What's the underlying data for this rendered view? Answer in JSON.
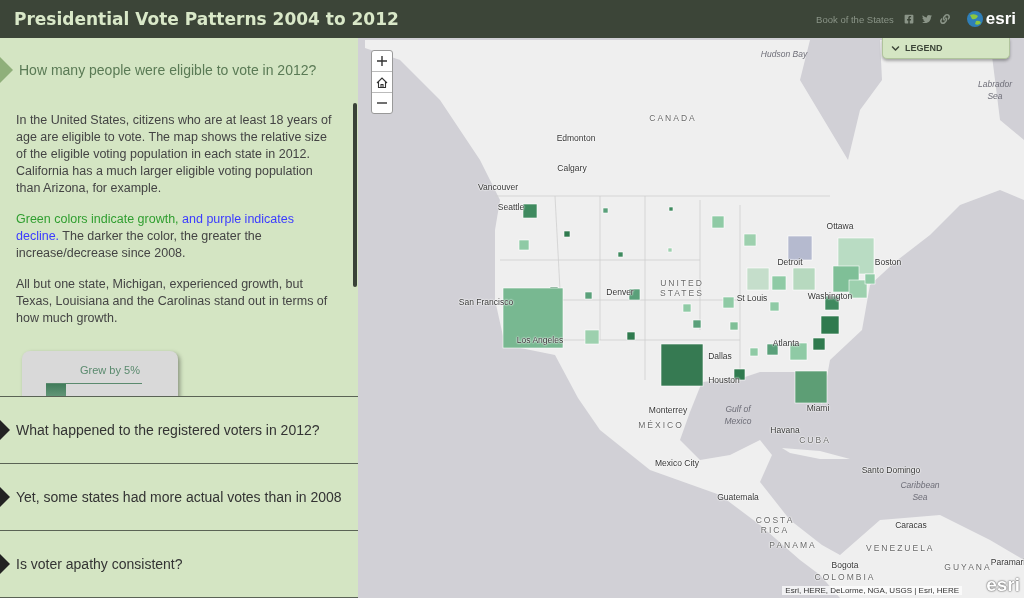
{
  "header": {
    "title": "Presidential Vote Patterns 2004 to 2012",
    "link": "Book of the States",
    "logo": "esri"
  },
  "sections": [
    {
      "title": "How many people were eligible to vote in 2012?",
      "expanded": true,
      "paragraphs": [
        [
          {
            "text": "In the United States, citizens who are at least 18 years of age are eligible to vote. The map shows the relative size of the eligible voting population in each state in 2012. California has a much larger eligible voting population than Arizona, for example."
          }
        ],
        [
          {
            "text": "Green colors indicate growth, ",
            "color": "#2f9e2f"
          },
          {
            "text": "and purple indicates decline.",
            "color": "#3b3bff"
          },
          {
            "text": " The darker the color, the greater the increase/decrease since 2008."
          }
        ],
        [
          {
            "text": "All but one state, Michigan, experienced growth, but Texas, Louisiana and the Carolinas stand out in terms of how much growth."
          }
        ]
      ],
      "chart_title": "Grew by 5%"
    },
    {
      "title": "What happened to the registered voters in 2012?",
      "expanded": false
    },
    {
      "title": "Yet, some states had more actual votes than in 2008",
      "expanded": false
    },
    {
      "title": "Is voter apathy consistent?",
      "expanded": false
    }
  ],
  "map": {
    "legend": {
      "label": "LEGEND",
      "expanded": false
    },
    "labels": [
      {
        "text": "Hudson Bay",
        "kind": "water"
      },
      {
        "text": "Labrador Sea",
        "kind": "water"
      },
      {
        "text": "CANADA",
        "kind": "country"
      },
      {
        "text": "Edmonton",
        "kind": "city"
      },
      {
        "text": "Calgary",
        "kind": "city"
      },
      {
        "text": "Vancouver",
        "kind": "city"
      },
      {
        "text": "Seattle",
        "kind": "city"
      },
      {
        "text": "Ottawa",
        "kind": "city"
      },
      {
        "text": "Detroit",
        "kind": "city"
      },
      {
        "text": "Boston",
        "kind": "city"
      },
      {
        "text": "Denver",
        "kind": "city"
      },
      {
        "text": "UNITED STATES",
        "kind": "country"
      },
      {
        "text": "St Louis",
        "kind": "city"
      },
      {
        "text": "Washington",
        "kind": "city"
      },
      {
        "text": "San Francisco",
        "kind": "city"
      },
      {
        "text": "Los Angeles",
        "kind": "city"
      },
      {
        "text": "Atlanta",
        "kind": "city"
      },
      {
        "text": "Dallas",
        "kind": "city"
      },
      {
        "text": "Houston",
        "kind": "city"
      },
      {
        "text": "Monterrey",
        "kind": "city"
      },
      {
        "text": "MÉXICO",
        "kind": "country"
      },
      {
        "text": "Gulf of Mexico",
        "kind": "water"
      },
      {
        "text": "Miami",
        "kind": "city"
      },
      {
        "text": "Havana",
        "kind": "city"
      },
      {
        "text": "CUBA",
        "kind": "country"
      },
      {
        "text": "Santo Domingo",
        "kind": "city"
      },
      {
        "text": "Mexico City",
        "kind": "city"
      },
      {
        "text": "Guatemala",
        "kind": "city"
      },
      {
        "text": "Caribbean Sea",
        "kind": "water"
      },
      {
        "text": "COSTA RICA",
        "kind": "country"
      },
      {
        "text": "Caracas",
        "kind": "city"
      },
      {
        "text": "PANAMA",
        "kind": "country"
      },
      {
        "text": "VENEZUELA",
        "kind": "country"
      },
      {
        "text": "Paramari",
        "kind": "city"
      },
      {
        "text": "GUYANA",
        "kind": "country"
      },
      {
        "text": "Bogota",
        "kind": "city"
      },
      {
        "text": "COLOMBIA",
        "kind": "country"
      }
    ],
    "attribution": "Esri, HERE, DeLorme, NGA, USGS | Esri, HERE",
    "logo": "esri"
  }
}
